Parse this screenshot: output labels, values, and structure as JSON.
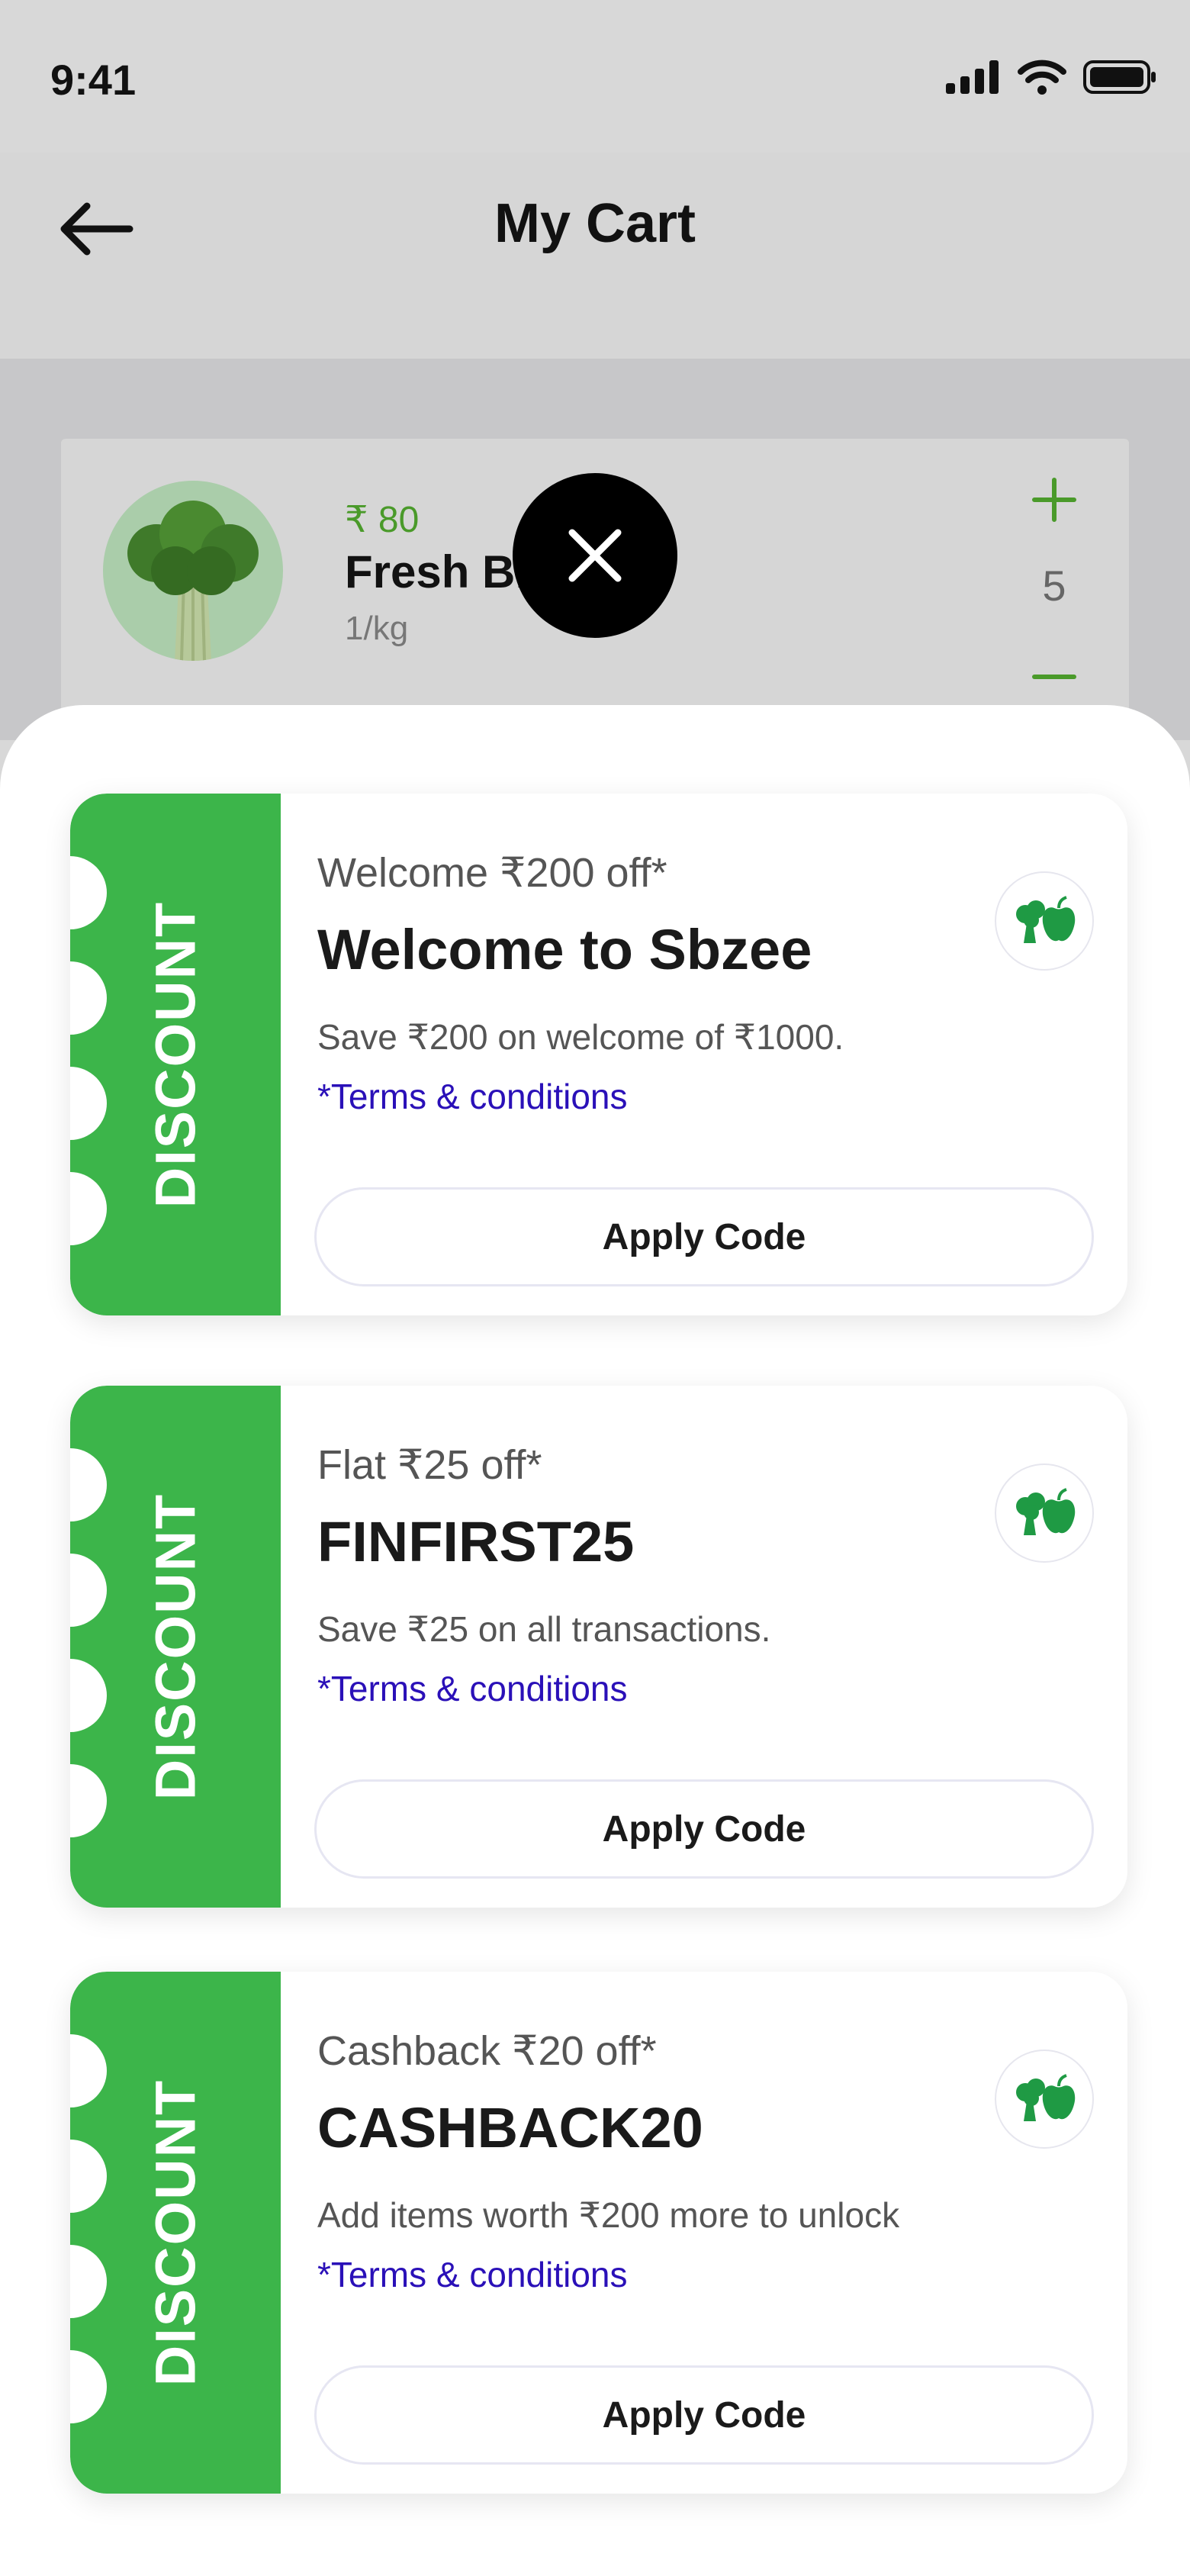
{
  "status_bar": {
    "time": "9:41"
  },
  "header": {
    "title": "My Cart"
  },
  "cart_item": {
    "price": "₹ 80",
    "name": "Fresh Br",
    "unit": "1/kg",
    "quantity": "5"
  },
  "coupons": [
    {
      "label": "DISCOUNT",
      "title": "Welcome ₹200 off*",
      "code": "Welcome to Sbzee",
      "description": "Save ₹200 on welcome of ₹1000.",
      "terms": "*Terms & conditions",
      "button": "Apply Code"
    },
    {
      "label": "DISCOUNT",
      "title": "Flat ₹25 off*",
      "code": "FINFIRST25",
      "description": "Save ₹25 on all transactions.",
      "terms": "*Terms & conditions",
      "button": "Apply Code"
    },
    {
      "label": "DISCOUNT",
      "title": "Cashback ₹20 off*",
      "code": "CASHBACK20",
      "description": "Add items worth ₹200 more to unlock",
      "terms": "*Terms & conditions",
      "button": "Apply Code"
    }
  ],
  "colors": {
    "accent_green": "#3cb54a",
    "terms_link": "#2a10b8",
    "price_green": "#4a9a2a"
  },
  "icons": {
    "back": "arrow-left-icon",
    "close": "close-icon",
    "brand": "veggie-logo-icon"
  }
}
